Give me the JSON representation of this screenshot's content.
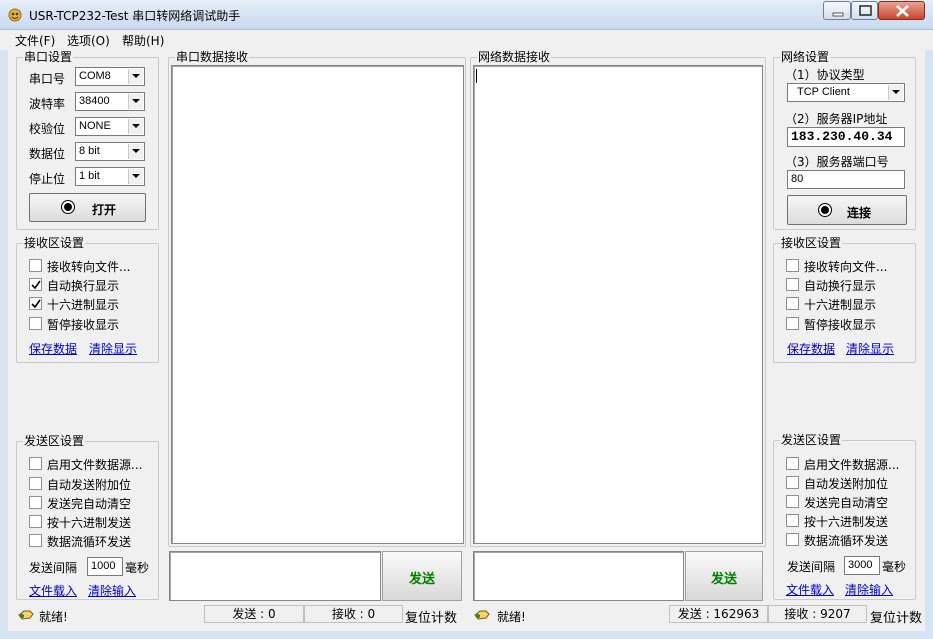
{
  "window": {
    "title": "USR-TCP232-Test 串口转网络调试助手"
  },
  "menu": [
    "文件(F)",
    "选项(O)",
    "帮助(H)"
  ],
  "serial": {
    "group_title": "串口设置",
    "port_label": "串口号",
    "port_value": "COM8",
    "baud_label": "波特率",
    "baud_value": "38400",
    "parity_label": "校验位",
    "parity_value": "NONE",
    "databits_label": "数据位",
    "databits_value": "8 bit",
    "stopbits_label": "停止位",
    "stopbits_value": "1 bit",
    "open_button": "打开"
  },
  "left_recv": {
    "group_title": "接收区设置",
    "options": [
      {
        "label": "接收转向文件...",
        "checked": false
      },
      {
        "label": "自动换行显示",
        "checked": true
      },
      {
        "label": "十六进制显示",
        "checked": true
      },
      {
        "label": "暂停接收显示",
        "checked": false
      }
    ],
    "save_link": "保存数据",
    "clear_link": "清除显示"
  },
  "left_send": {
    "group_title": "发送区设置",
    "options": [
      {
        "label": "启用文件数据源...",
        "checked": false
      },
      {
        "label": "自动发送附加位",
        "checked": false
      },
      {
        "label": "发送完自动清空",
        "checked": false
      },
      {
        "label": "按十六进制发送",
        "checked": false
      },
      {
        "label": "数据流循环发送",
        "checked": false
      }
    ],
    "interval_label": "发送间隔",
    "interval_value": "1000",
    "interval_unit": "毫秒",
    "load_link": "文件载入",
    "clear_link": "清除输入"
  },
  "serial_recv_title": "串口数据接收",
  "net_recv_title": "网络数据接收",
  "send_label": "发送",
  "network": {
    "group_title": "网络设置",
    "protocol_label": "（1）协议类型",
    "protocol_value": "TCP Client",
    "ip_label": "（2）服务器IP地址",
    "ip_value": "183.230.40.34",
    "port_label": "（3）服务器端口号",
    "port_value": "80",
    "connect_button": "连接"
  },
  "right_recv": {
    "group_title": "接收区设置",
    "options": [
      {
        "label": "接收转向文件...",
        "checked": false
      },
      {
        "label": "自动换行显示",
        "checked": false
      },
      {
        "label": "十六进制显示",
        "checked": false
      },
      {
        "label": "暂停接收显示",
        "checked": false
      }
    ],
    "save_link": "保存数据",
    "clear_link": "清除显示"
  },
  "right_send": {
    "group_title": "发送区设置",
    "options": [
      {
        "label": "启用文件数据源...",
        "checked": false
      },
      {
        "label": "自动发送附加位",
        "checked": false
      },
      {
        "label": "发送完自动清空",
        "checked": false
      },
      {
        "label": "按十六进制发送",
        "checked": false
      },
      {
        "label": "数据流循环发送",
        "checked": false
      }
    ],
    "interval_label": "发送间隔",
    "interval_value": "3000",
    "interval_unit": "毫秒",
    "load_link": "文件载入",
    "clear_link": "清除输入"
  },
  "status": {
    "left_ready": "就绪!",
    "left_sent": "发送 : 0",
    "left_recv": "接收 : 0",
    "left_reset": "复位计数",
    "right_ready": "就绪!",
    "right_sent": "发送 : 162963",
    "right_recv": "接收 : 9207",
    "right_reset": "复位计数"
  },
  "colors": {
    "send_text": "#008000",
    "link": "#0000cc",
    "panel": "#f0f0f0"
  }
}
